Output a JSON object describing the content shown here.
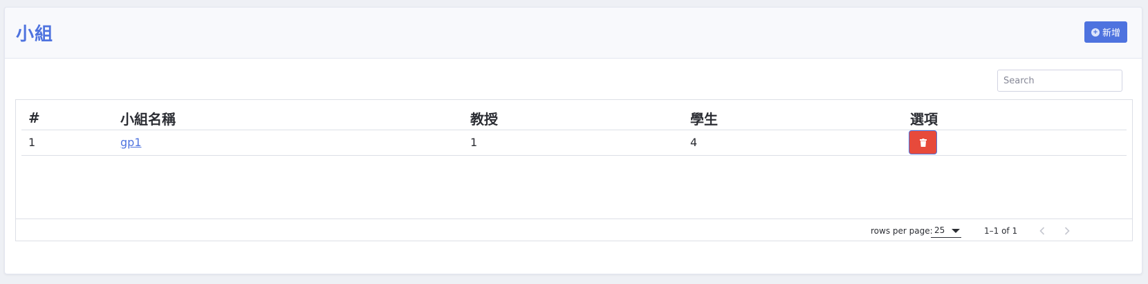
{
  "header": {
    "title": "小組",
    "add_button_label": "新增",
    "add_icon": "plus-circle-icon"
  },
  "search": {
    "placeholder": "Search",
    "value": ""
  },
  "table": {
    "columns": [
      "#",
      "小組名稱",
      "教授",
      "學生",
      "選項"
    ],
    "rows": [
      {
        "index": "1",
        "name": "gp1",
        "professors": "1",
        "students": "4",
        "action_icon": "trash-icon"
      }
    ]
  },
  "pagination": {
    "rows_per_page_label": "rows per page:",
    "rows_per_page_value": "25",
    "range_text": "1–1 of 1",
    "prev_icon": "chevron-left-icon",
    "next_icon": "chevron-right-icon"
  },
  "colors": {
    "accent": "#4e73df",
    "danger": "#e74a3b"
  }
}
